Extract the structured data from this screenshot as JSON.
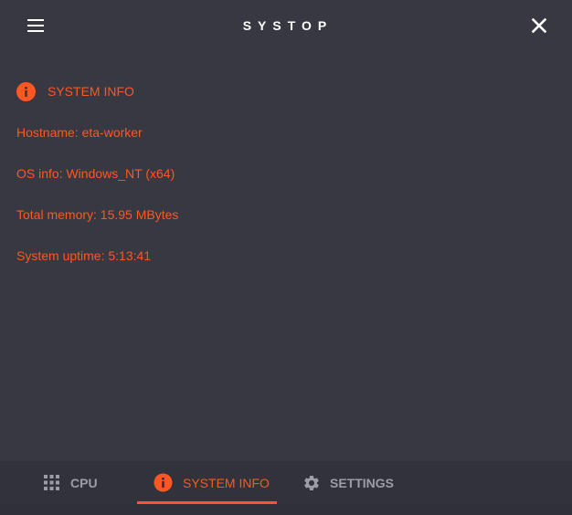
{
  "header": {
    "title": "SYSTOP",
    "menu_icon": "hamburger-menu-icon",
    "close_icon": "close-icon"
  },
  "content": {
    "section_title": "SYSTEM INFO",
    "section_icon": "info-icon",
    "hostname": "Hostname: eta-worker",
    "os_info": "OS info: Windows_NT (x64)",
    "total_memory": "Total memory: 15.95 MBytes",
    "uptime": "System uptime: 5:13:41"
  },
  "bottom_nav": {
    "tabs": [
      {
        "label": "CPU",
        "icon": "grid-icon",
        "active": false
      },
      {
        "label": "SYSTEM INFO",
        "icon": "info-icon",
        "active": true
      },
      {
        "label": "SETTINGS",
        "icon": "gear-icon",
        "active": false
      }
    ]
  },
  "colors": {
    "background": "#373841",
    "accent": "#ff5722",
    "nav_background": "#31323a",
    "inactive_tab": "#9c9ea6",
    "title_text": "#ffffff"
  }
}
